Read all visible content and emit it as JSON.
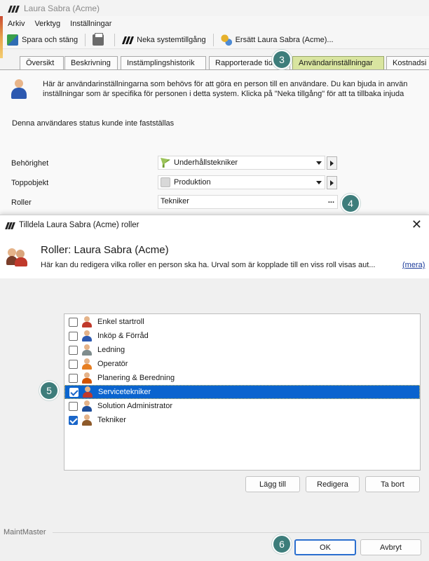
{
  "window": {
    "title": "Laura Sabra (Acme)"
  },
  "menu": [
    "Arkiv",
    "Verktyg",
    "Inställningar"
  ],
  "toolbar": {
    "save_close": "Spara och stäng",
    "deny_access": "Neka systemtillgång",
    "replace": "Ersätt Laura Sabra (Acme)..."
  },
  "tabs": [
    {
      "label": "Översikt",
      "active": false
    },
    {
      "label": "Beskrivning",
      "active": false
    },
    {
      "label": "Instämplingshistorik",
      "active": false
    },
    {
      "label": "Rapporterade tid",
      "active": false
    },
    {
      "label": "Användarinställningar",
      "active": true
    },
    {
      "label": "Kostnadsi",
      "active": false
    }
  ],
  "content": {
    "intro_line1": "Här är användarinställningarna som behövs för att göra en person till en användare. Du kan bjuda in använ",
    "intro_line2": "inställningar som är specifika för personen i detta system. Klicka på \"Neka tillgång\" för att ta tillbaka injuda",
    "status": "Denna användares status kunde inte fastställas",
    "fields": {
      "permission_label": "Behörighet",
      "permission_value": "Underhållstekniker",
      "top_object_label": "Toppobjekt",
      "top_object_value": "Produktion",
      "roles_label": "Roller",
      "roles_value": "Tekniker",
      "roles_browse": "..."
    }
  },
  "badges": {
    "b3": "3",
    "b4": "4",
    "b5": "5",
    "b6": "6"
  },
  "dialog": {
    "title": "Tilldela Laura Sabra (Acme) roller",
    "header_title": "Roller: Laura Sabra (Acme)",
    "header_desc": "Här kan du redigera vilka roller en person ska ha. Urval som är kopplade till en viss roll visas aut...",
    "more_link": "(mera)",
    "roles": [
      {
        "label": "Enkel startroll",
        "checked": false,
        "selected": false,
        "color": "#c0392b"
      },
      {
        "label": "Inköp & Förråd",
        "checked": false,
        "selected": false,
        "color": "#2d59b0"
      },
      {
        "label": "Ledning",
        "checked": false,
        "selected": false,
        "color": "#7f8c8d"
      },
      {
        "label": "Operatör",
        "checked": false,
        "selected": false,
        "color": "#e67e22"
      },
      {
        "label": "Planering & Beredning",
        "checked": false,
        "selected": false,
        "color": "#d35400"
      },
      {
        "label": "Servicetekniker",
        "checked": true,
        "selected": true,
        "color": "#c0392b"
      },
      {
        "label": "Solution Administrator",
        "checked": false,
        "selected": false,
        "color": "#1f4e9a"
      },
      {
        "label": "Tekniker",
        "checked": true,
        "selected": false,
        "color": "#8e5a2a"
      }
    ],
    "buttons": {
      "add": "Lägg till",
      "edit": "Redigera",
      "remove": "Ta bort",
      "ok": "OK",
      "cancel": "Avbryt"
    },
    "footer_label": "MaintMaster"
  },
  "colors": {
    "accent": "#2b6fcf",
    "badge": "#3d7d7b",
    "active_tab": "#d9e5a0",
    "selection": "#0a64cf"
  }
}
